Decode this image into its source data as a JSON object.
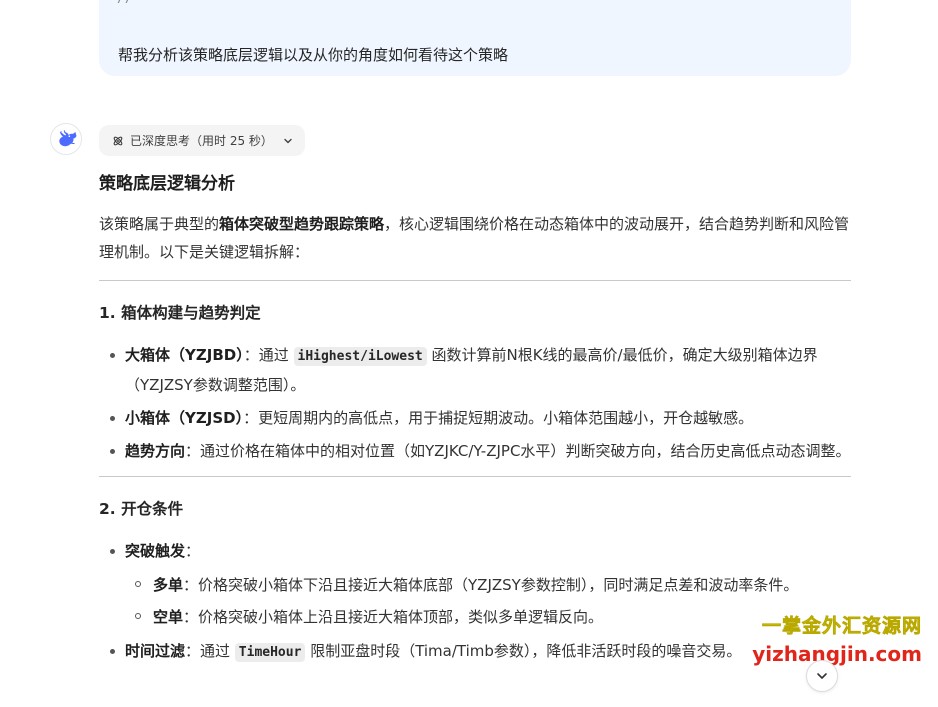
{
  "user_message": {
    "code_line": "//---------------------------  -------------------------------------------",
    "text": "帮我分析该策略底层逻辑以及从你的角度如何看待这个策略"
  },
  "assistant": {
    "avatar_icon": "whale-logo-icon",
    "thinking_label": "已深度思考（用时 25 秒）",
    "section_title": "策略底层逻辑分析",
    "lead_prefix": "该策略属于典型的",
    "lead_bold": "箱体突破型趋势跟踪策略",
    "lead_suffix": "，核心逻辑围绕价格在动态箱体中的波动展开，结合趋势判断和风险管理机制。以下是关键逻辑拆解：",
    "sections": [
      {
        "heading": "1. 箱体构建与趋势判定",
        "items": [
          {
            "bold": "大箱体（YZJBD）",
            "pre": "：通过 ",
            "code": "iHighest/iLowest",
            "post": " 函数计算前N根K线的最高价/最低价，确定大级别箱体边界（YZJZSY参数调整范围）。"
          },
          {
            "bold": "小箱体（YZJSD）",
            "text": "：更短周期内的高低点，用于捕捉短期波动。小箱体范围越小，开仓越敏感。"
          },
          {
            "bold": "趋势方向",
            "text": "：通过价格在箱体中的相对位置（如YZJKC/Y-ZJPC水平）判断突破方向，结合历史高低点动态调整。"
          }
        ]
      },
      {
        "heading": "2. 开仓条件",
        "items": [
          {
            "bold": "突破触发",
            "text": "：",
            "sub": [
              {
                "bold": "多单",
                "text": "：价格突破小箱体下沿且接近大箱体底部（YZJZSY参数控制），同时满足点差和波动率条件。"
              },
              {
                "bold": "空单",
                "text": "：价格突破小箱体上沿且接近大箱体顶部，类似多单逻辑反向。"
              }
            ]
          },
          {
            "bold": "时间过滤",
            "pre": "：通过 ",
            "code": "TimeHour",
            "post": " 限制亚盘时段（Tima/Timb参数），降低非活跃时段的噪音交易。"
          }
        ]
      }
    ]
  },
  "watermark": {
    "cn": "一掌金外汇资源网",
    "url": "yizhangjin.com"
  },
  "colors": {
    "bubble_bg": "#eff6ff",
    "chip_bg": "#f4f4f5",
    "watermark_cn": "#f0e400",
    "watermark_url": "#e0261b",
    "logo_blue": "#4d6bfe"
  }
}
